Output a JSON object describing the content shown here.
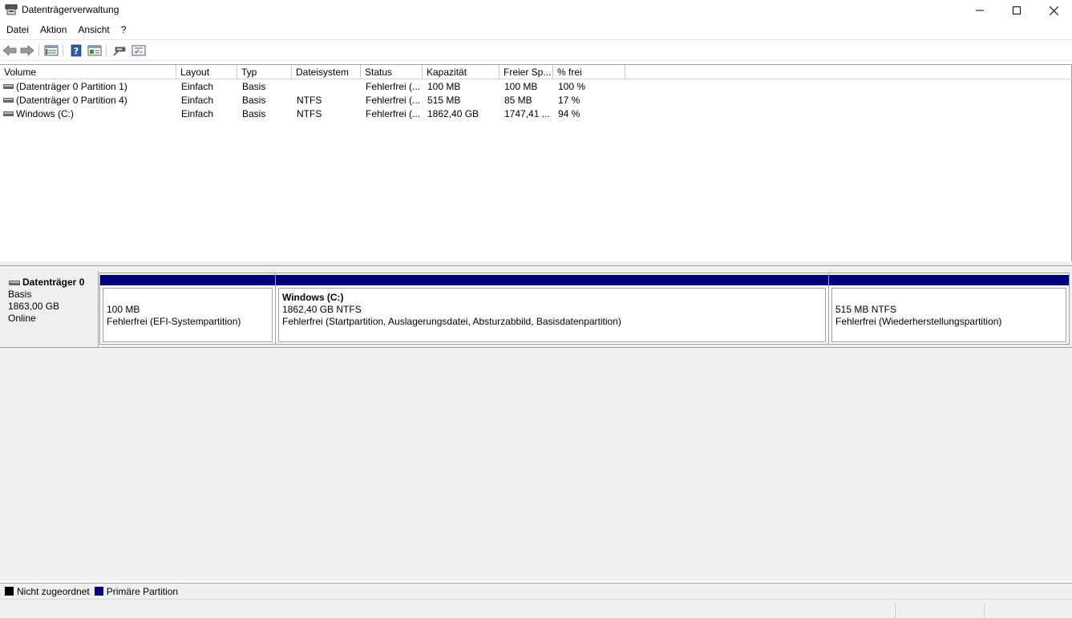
{
  "window": {
    "title": "Datenträgerverwaltung",
    "icon": "disk-management-icon",
    "controls": [
      "minimize-icon",
      "maximize-icon",
      "close-icon"
    ]
  },
  "menu": {
    "items": [
      "Datei",
      "Aktion",
      "Ansicht",
      "?"
    ]
  },
  "toolbar": {
    "buttons": [
      "back-arrow-icon",
      "forward-arrow-icon",
      "disk-list-view-icon",
      "help-icon",
      "properties-view-icon",
      "rescan-disks-icon",
      "settings-list-icon"
    ]
  },
  "volume_list": {
    "columns": [
      "Volume",
      "Layout",
      "Typ",
      "Dateisystem",
      "Status",
      "Kapazität",
      "Freier Sp...",
      "% frei"
    ],
    "rows": [
      {
        "volume": "(Datenträger 0 Partition 1)",
        "layout": "Einfach",
        "typ": "Basis",
        "dateisystem": "",
        "status": "Fehlerfrei (...",
        "kapazitaet": "100 MB",
        "freier": "100 MB",
        "frei_pct": "100 %"
      },
      {
        "volume": "(Datenträger 0 Partition 4)",
        "layout": "Einfach",
        "typ": "Basis",
        "dateisystem": "NTFS",
        "status": "Fehlerfrei (...",
        "kapazitaet": "515 MB",
        "freier": "85 MB",
        "frei_pct": "17 %"
      },
      {
        "volume": "Windows (C:)",
        "layout": "Einfach",
        "typ": "Basis",
        "dateisystem": "NTFS",
        "status": "Fehlerfrei (...",
        "kapazitaet": "1862,40 GB",
        "freier": "1747,41 ...",
        "frei_pct": "94 %"
      }
    ]
  },
  "disk": {
    "name": "Datenträger 0",
    "type": "Basis",
    "size": "1863,00 GB",
    "state": "Online",
    "partitions": [
      {
        "title": "",
        "size": "100 MB",
        "status": "Fehlerfrei (EFI-Systempartition)"
      },
      {
        "title": "Windows  (C:)",
        "size": "1862,40 GB NTFS",
        "status": "Fehlerfrei (Startpartition, Auslagerungsdatei, Absturzabbild, Basisdatenpartition)"
      },
      {
        "title": "",
        "size": "515 MB NTFS",
        "status": "Fehlerfrei (Wiederherstellungspartition)"
      }
    ]
  },
  "legend": {
    "items": [
      {
        "label": "Nicht zugeordnet",
        "color": "#000000"
      },
      {
        "label": "Primäre Partition",
        "color": "#00007f"
      }
    ]
  },
  "colors": {
    "primary_partition": "#00007f",
    "unallocated": "#000000"
  }
}
